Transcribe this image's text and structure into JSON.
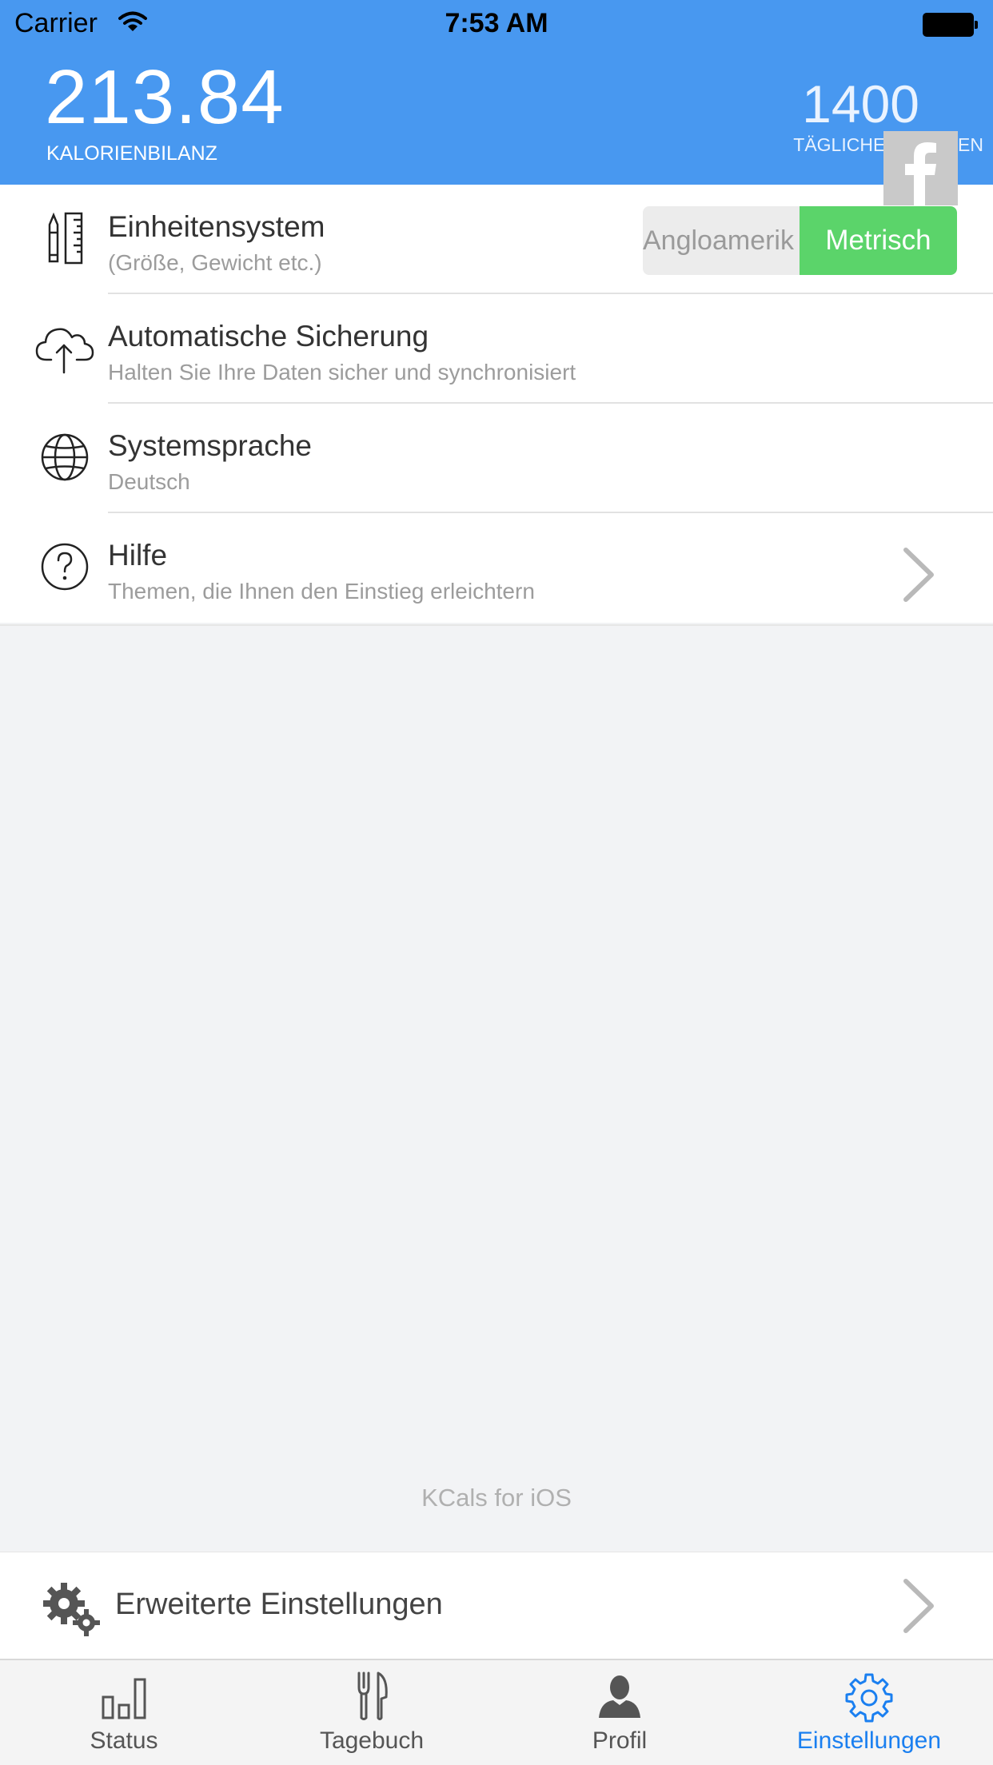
{
  "status_bar": {
    "carrier": "Carrier",
    "time": "7:53 AM"
  },
  "header": {
    "balance_value": "213.84",
    "balance_label": "KALORIENBILANZ",
    "daily_value": "1400",
    "daily_label": "TÄGLICHE KALORIEN"
  },
  "settings": {
    "units": {
      "title": "Einheitensystem",
      "subtitle": "(Größe, Gewicht etc.)",
      "option_left": "Angloamerik",
      "option_right": "Metrisch",
      "selected": "Metrisch"
    },
    "backup": {
      "title": "Automatische Sicherung",
      "subtitle": "Halten Sie Ihre Daten sicher und synchronisiert"
    },
    "language": {
      "title": "Systemsprache",
      "subtitle": "Deutsch"
    },
    "help": {
      "title": "Hilfe",
      "subtitle": "Themen, die Ihnen den Einstieg erleichtern"
    }
  },
  "footer_note": "KCals for iOS",
  "advanced": {
    "title": "Erweiterte Einstellungen"
  },
  "tabs": [
    {
      "label": "Status",
      "icon": "bar-chart-icon"
    },
    {
      "label": "Tagebuch",
      "icon": "fork-knife-icon"
    },
    {
      "label": "Profil",
      "icon": "person-icon"
    },
    {
      "label": "Einstellungen",
      "icon": "gear-icon",
      "active": true
    }
  ],
  "colors": {
    "header_bg": "#4898f0",
    "accent_green": "#5bd46a",
    "active_tab": "#1a7ff0"
  }
}
